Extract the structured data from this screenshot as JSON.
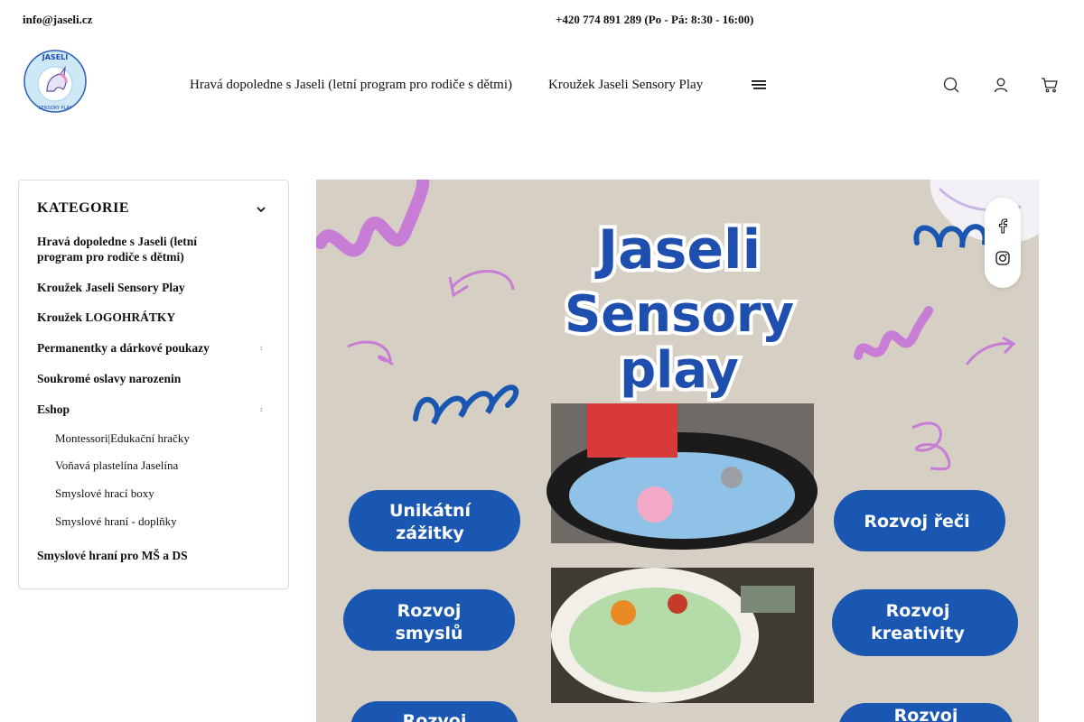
{
  "topbar": {
    "email": "info@jaseli.cz",
    "phone": "+420 774 891 289 (Po - Pá: 8:30 - 16:00)"
  },
  "logo": {
    "line1": "JASELI",
    "line2": "SENSORY PLAY"
  },
  "nav": {
    "items": [
      "Hravá dopoledne s Jaseli (letní program pro rodiče s dětmi)",
      "Kroužek Jaseli Sensory Play"
    ]
  },
  "sidebar": {
    "title": "KATEGORIE",
    "items": [
      "Hravá dopoledne s Jaseli (letní program pro rodiče s dětmi)",
      "Kroužek Jaseli Sensory Play",
      "Kroužek LOGOHRÁTKY",
      "Permanentky a dárkové poukazy",
      "Soukromé oslavy narozenin",
      "Eshop",
      "Smyslové hraní pro MŠ a DS"
    ],
    "subitems": [
      "Montessori|Edukační hračky",
      "Voňavá plastelína Jaselína",
      "Smyslové hrací boxy",
      "Smyslové hraní - doplňky"
    ]
  },
  "banner": {
    "title_line1": "Jaseli",
    "title_line2": "Sensory",
    "title_line3": "play",
    "pills": [
      [
        "Unikátní",
        "zážitky"
      ],
      [
        "Rozvoj řeči"
      ],
      [
        "Rozvoj",
        "smyslů"
      ],
      [
        "Rozvoj",
        "kreativity"
      ],
      [
        "Rozvoj"
      ],
      [
        "Rozvoj"
      ]
    ]
  },
  "colors": {
    "banner_bg": "#d6d0c4",
    "pill_blue": "#1a57b3",
    "title_blue": "#1f4fae",
    "doodle_purple": "#c77dd6"
  }
}
